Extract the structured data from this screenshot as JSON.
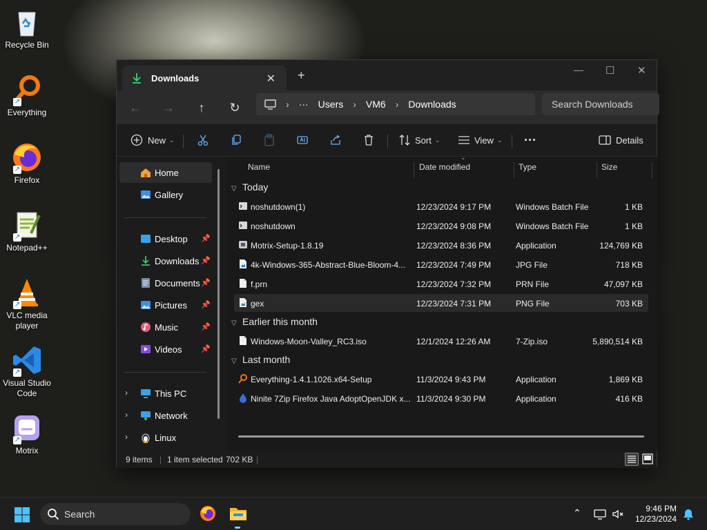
{
  "desktop": {
    "icons": [
      {
        "label": "Recycle Bin"
      },
      {
        "label": "Everything"
      },
      {
        "label": "Firefox"
      },
      {
        "label": "Notepad++"
      },
      {
        "label": "VLC media player"
      },
      {
        "label": "Visual Studio Code"
      },
      {
        "label": "Motrix"
      }
    ]
  },
  "explorer": {
    "tab_title": "Downloads",
    "new_tab": "+",
    "breadcrumb": [
      "Users",
      "VM6",
      "Downloads"
    ],
    "breadcrumb_overflow": "···",
    "search_placeholder": "Search Downloads",
    "toolbar": {
      "new": "New",
      "sort": "Sort",
      "view": "View",
      "more": "···",
      "details": "Details"
    },
    "sidebar": {
      "home": "Home",
      "gallery": "Gallery",
      "pinned": [
        "Desktop",
        "Downloads",
        "Documents",
        "Pictures",
        "Music",
        "Videos"
      ],
      "this_pc": "This PC",
      "network": "Network",
      "linux": "Linux"
    },
    "columns": {
      "name": "Name",
      "date": "Date modified",
      "type": "Type",
      "size": "Size"
    },
    "groups": [
      {
        "title": "Today",
        "files": [
          {
            "name": "noshutdown(1)",
            "date": "12/23/2024 9:17 PM",
            "type": "Windows Batch File",
            "size": "1 KB",
            "icon": "batch-file-icon"
          },
          {
            "name": "noshutdown",
            "date": "12/23/2024 9:08 PM",
            "type": "Windows Batch File",
            "size": "1 KB",
            "icon": "batch-file-icon"
          },
          {
            "name": "Motrix-Setup-1.8.19",
            "date": "12/23/2024 8:36 PM",
            "type": "Application",
            "size": "124,769 KB",
            "icon": "app-file-icon"
          },
          {
            "name": "4k-Windows-365-Abstract-Blue-Bloom-4...",
            "date": "12/23/2024 7:49 PM",
            "type": "JPG File",
            "size": "718 KB",
            "icon": "image-file-icon"
          },
          {
            "name": "f.prn",
            "date": "12/23/2024 7:32 PM",
            "type": "PRN File",
            "size": "47,097 KB",
            "icon": "blank-file-icon"
          },
          {
            "name": "gex",
            "date": "12/23/2024 7:31 PM",
            "type": "PNG File",
            "size": "703 KB",
            "icon": "image-file-icon",
            "selected": true
          }
        ]
      },
      {
        "title": "Earlier this month",
        "files": [
          {
            "name": "Windows-Moon-Valley_RC3.iso",
            "date": "12/1/2024 12:26 AM",
            "type": "7-Zip.iso",
            "size": "5,890,514 KB",
            "icon": "blank-file-icon"
          }
        ]
      },
      {
        "title": "Last month",
        "files": [
          {
            "name": "Everything-1.4.1.1026.x64-Setup",
            "date": "11/3/2024 9:43 PM",
            "type": "Application",
            "size": "1,869 KB",
            "icon": "everything-app-icon"
          },
          {
            "name": "Ninite 7Zip Firefox Java AdoptOpenJDK x...",
            "date": "11/3/2024 9:30 PM",
            "type": "Application",
            "size": "416 KB",
            "icon": "ninite-app-icon"
          }
        ]
      }
    ],
    "status": {
      "items": "9 items",
      "selected": "1 item selected",
      "size": "702 KB"
    }
  },
  "taskbar": {
    "search": "Search",
    "time": "9:46 PM",
    "date": "12/23/2024"
  }
}
